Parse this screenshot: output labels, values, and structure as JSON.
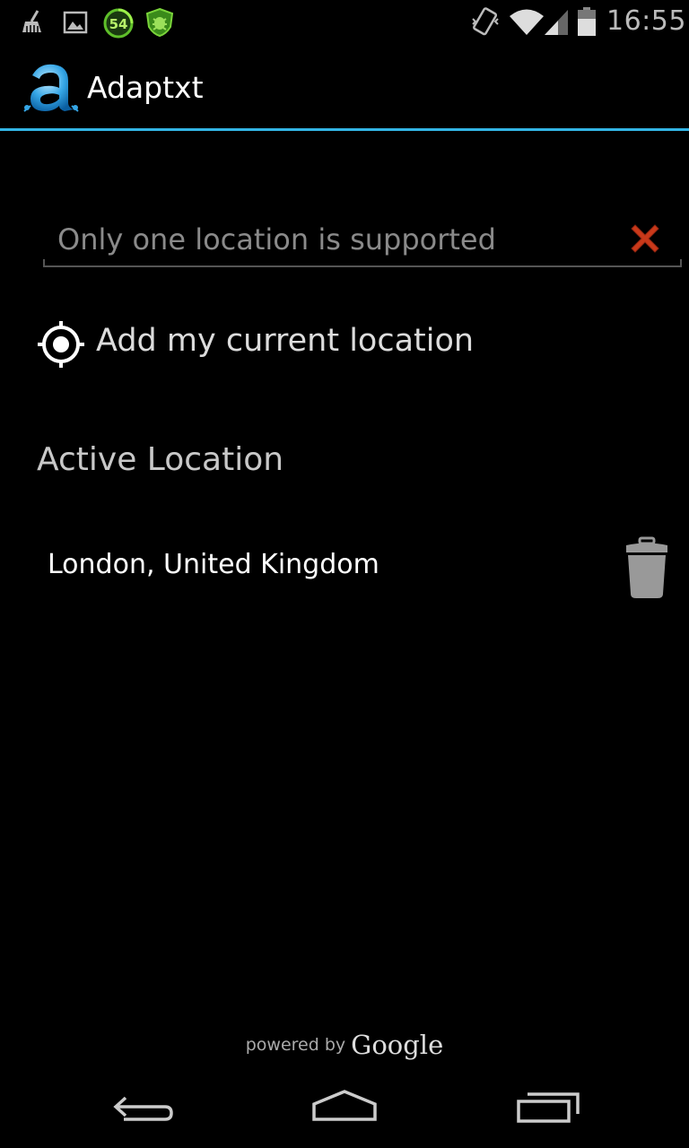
{
  "status_bar": {
    "icons": [
      "broom-icon",
      "image-icon",
      "battery-saver-badge-icon",
      "shield-bug-icon",
      "vibrate-icon",
      "wifi-icon",
      "cell-signal-icon",
      "battery-icon"
    ],
    "badge_number": "54",
    "time": "16:55"
  },
  "action_bar": {
    "title": "Adaptxt",
    "accent_color": "#33b5e5"
  },
  "search": {
    "placeholder": "Only one location is supported",
    "value": "",
    "clear_icon": "close-icon",
    "clear_color": "#c9391a"
  },
  "add_location": {
    "icon": "target-icon",
    "label": "Add my current location"
  },
  "active_section": {
    "title": "Active Location",
    "locations": [
      {
        "name": "London, United Kingdom",
        "action_icon": "trash-icon"
      }
    ]
  },
  "footer": {
    "prefix": "powered by",
    "brand": "Google"
  },
  "nav_bar": {
    "buttons": [
      "back-icon",
      "home-icon",
      "recent-apps-icon"
    ]
  }
}
